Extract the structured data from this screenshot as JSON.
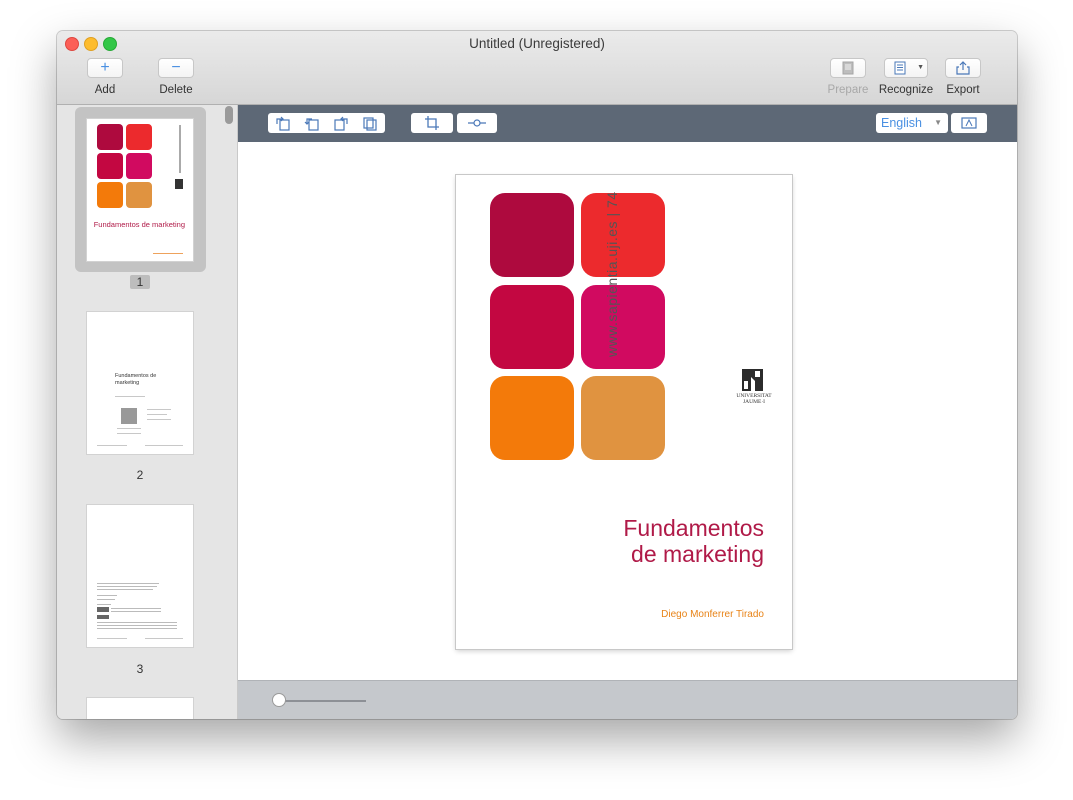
{
  "window": {
    "title": "Untitled (Unregistered)"
  },
  "toolbar": {
    "add_label": "Add",
    "delete_label": "Delete",
    "prepare_label": "Prepare",
    "recognize_label": "Recognize",
    "export_label": "Export"
  },
  "view_toolbar": {
    "language": "English"
  },
  "sidebar": {
    "pages": [
      {
        "number": "1",
        "title": "Fundamentos de marketing",
        "selected": true
      },
      {
        "number": "2",
        "title": "Fundamentos de marketing",
        "selected": false
      },
      {
        "number": "3",
        "selected": false
      }
    ]
  },
  "document": {
    "url": "www.sapientia.uji.es | 74",
    "title_line1": "Fundamentos",
    "title_line2": "de marketing",
    "author": "Diego Monferrer Tirado",
    "logo_text": "Universitat Jaume·I",
    "tile_colors": [
      "#ae0a3e",
      "#ec2a2d",
      "#c30741",
      "#d10a60",
      "#f37a0a",
      "#e09340"
    ]
  },
  "zoom": {
    "level": 0.0
  }
}
